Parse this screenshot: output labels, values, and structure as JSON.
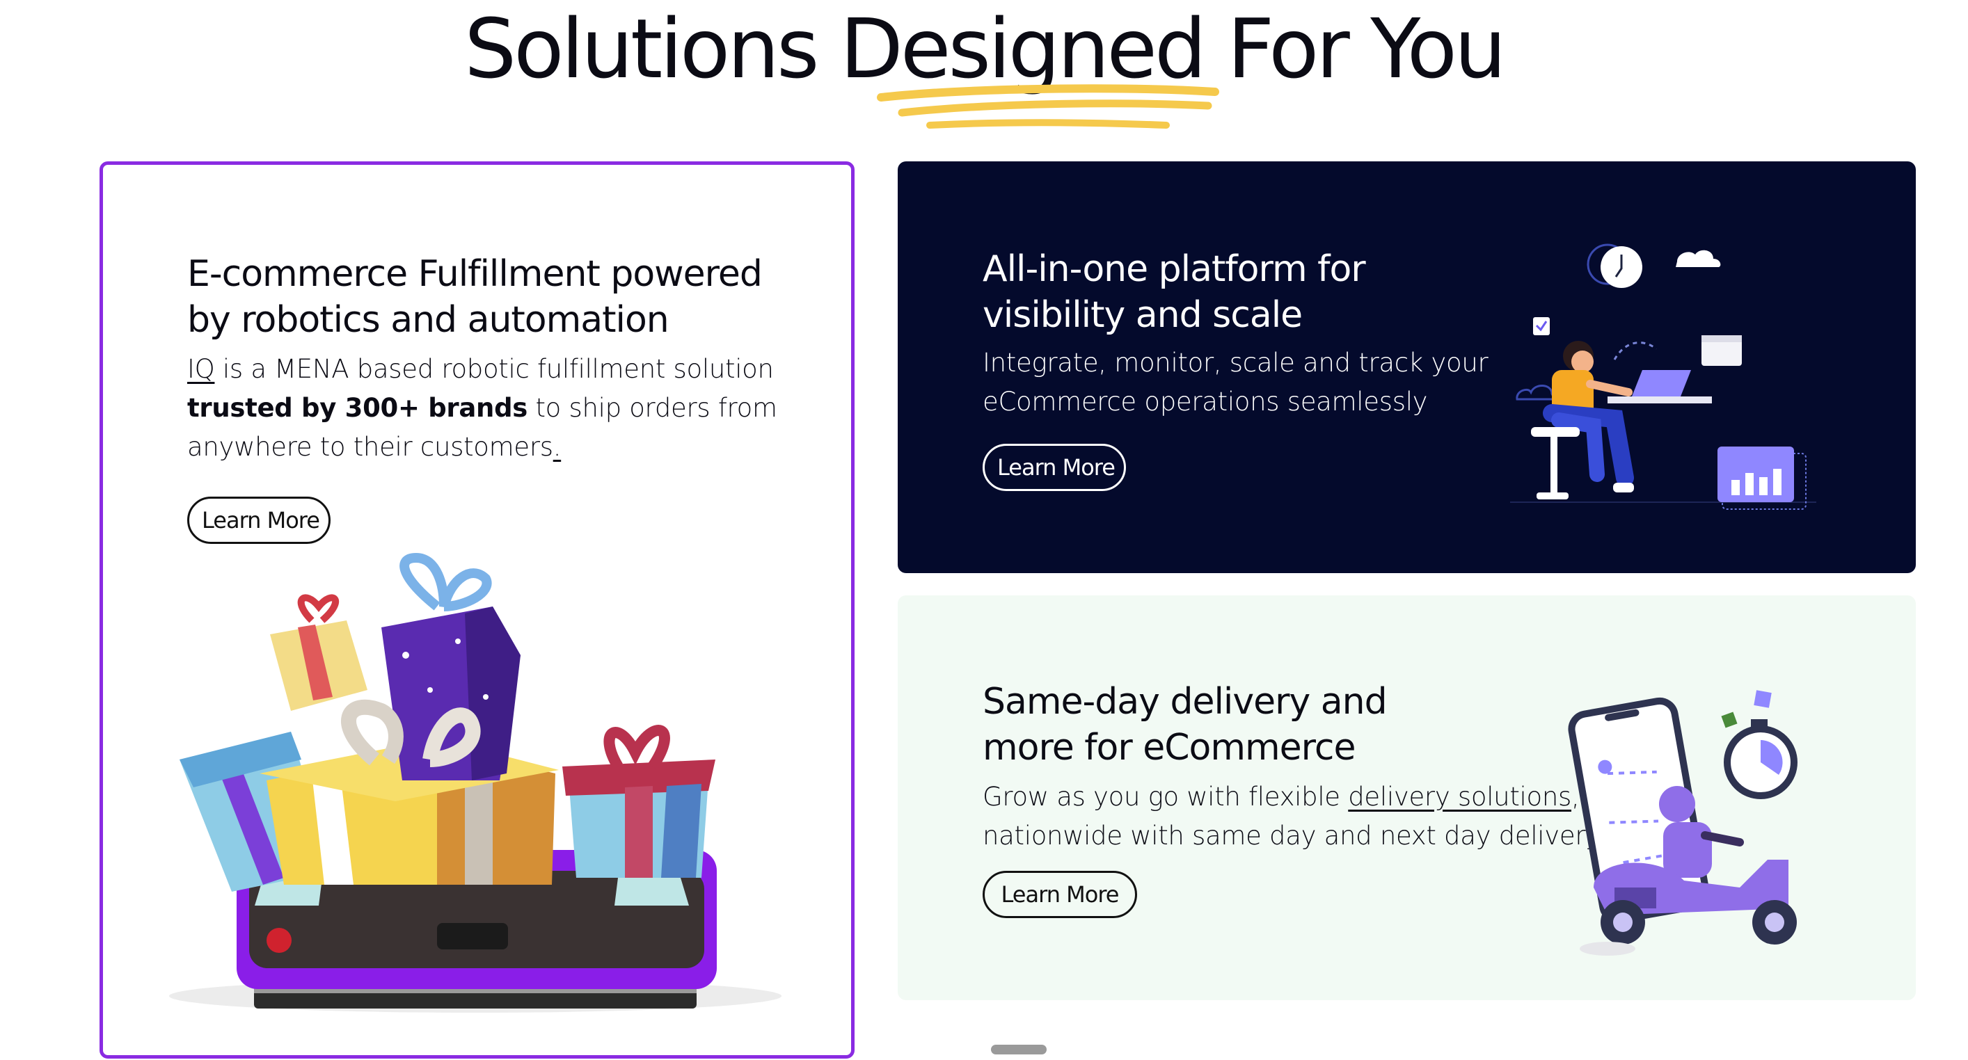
{
  "section": {
    "title_prefix": "Solutions ",
    "title_highlight": "Designed",
    "title_suffix": " For You",
    "highlight_color": "#f5c94c"
  },
  "cards": [
    {
      "heading": "E-commerce Fulfillment powered by robotics and automation",
      "body_link": "IQ",
      "body_1": " is a MENA based robotic fulfillment solution ",
      "body_bold": "trusted by 300+ brands",
      "body_2": " to ship orders from anywhere to their customers",
      "body_link_end": ".",
      "button": "Learn More",
      "border_color": "#8a2be2",
      "illustration": "gift-boxes-on-robot-icon"
    },
    {
      "heading": "All-in-one platform for visibility and scale",
      "body": "Integrate, monitor, scale and track your eCommerce operations seamlessly",
      "button": "Learn More",
      "background": "#040a2c",
      "illustration": "person-at-laptop-icon"
    },
    {
      "heading": "Same-day delivery and more for eCommerce",
      "body_1": "Grow as you go with flexible ",
      "body_link": "delivery solutions",
      "body_2": ", nationwide with same day and next day delivery.",
      "button": "Learn More",
      "background": "#f2faf4",
      "illustration": "scooter-delivery-icon"
    }
  ]
}
